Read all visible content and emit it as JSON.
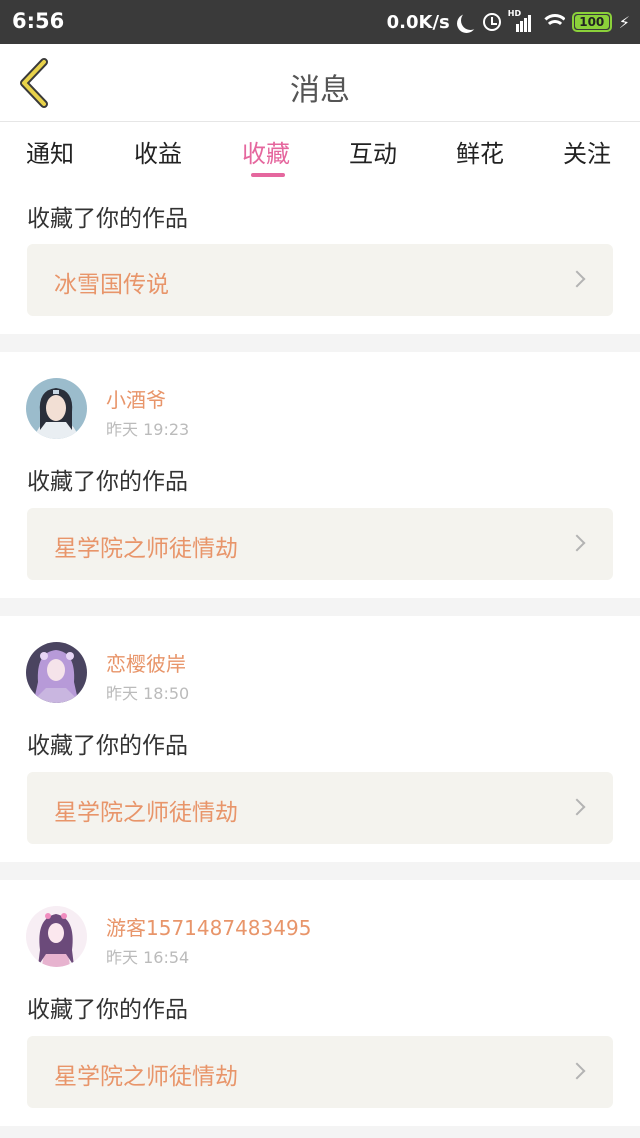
{
  "status_bar": {
    "time": "6:56",
    "net_speed": "0.0K/s",
    "signal_label": "HD",
    "battery": "100"
  },
  "header": {
    "title": "消息"
  },
  "tabs": [
    {
      "label": "通知",
      "active": false
    },
    {
      "label": "收益",
      "active": false
    },
    {
      "label": "收藏",
      "active": true
    },
    {
      "label": "互动",
      "active": false
    },
    {
      "label": "鲜花",
      "active": false
    },
    {
      "label": "关注",
      "active": false
    }
  ],
  "colors": {
    "accent_pink": "#e5679e",
    "accent_orange": "#e8956a"
  },
  "messages": [
    {
      "user": "",
      "time": "",
      "action": "收藏了你的作品",
      "work": "冰雪国传说"
    },
    {
      "user": "小酒爷",
      "time": "昨天 19:23",
      "action": "收藏了你的作品",
      "work": "星学院之师徒情劫"
    },
    {
      "user": "恋樱彼岸",
      "time": "昨天 18:50",
      "action": "收藏了你的作品",
      "work": "星学院之师徒情劫"
    },
    {
      "user": "游客1571487483495",
      "time": "昨天 16:54",
      "action": "收藏了你的作品",
      "work": "星学院之师徒情劫"
    }
  ]
}
